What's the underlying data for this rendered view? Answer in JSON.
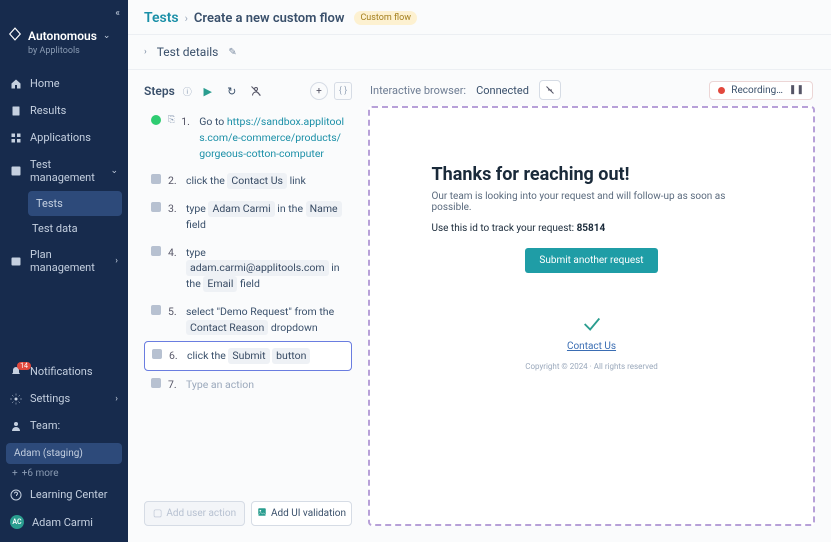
{
  "brand": {
    "name": "Autonomous",
    "subtitle": "by Applitools"
  },
  "nav": [
    {
      "label": "Home"
    },
    {
      "label": "Results"
    },
    {
      "label": "Applications"
    },
    {
      "label": "Test management",
      "children": [
        {
          "label": "Tests"
        },
        {
          "label": "Test data"
        }
      ]
    },
    {
      "label": "Plan management"
    }
  ],
  "bottom": {
    "notifications": "Notifications",
    "notif_badge": "14",
    "settings": "Settings",
    "team": "Team:",
    "team_selected": "Adam (staging)",
    "more": "+6 more",
    "learning": "Learning Center",
    "user_initials": "AC",
    "user_name": "Adam Carmi"
  },
  "header": {
    "root": "Tests",
    "title": "Create a new custom flow",
    "pill": "Custom flow",
    "details": "Test details"
  },
  "steps": {
    "title": "Steps",
    "items": [
      {
        "num": "1.",
        "pre": "Go to",
        "link": "https://sandbox.applitools.com/e-commerce/products/gorgeous-cotton-computer"
      },
      {
        "num": "2.",
        "t0": "click the",
        "c0": "Contact Us",
        "t1": "link"
      },
      {
        "num": "3.",
        "t0": "type",
        "c0": "Adam Carmi",
        "t1": "in the",
        "c1": "Name",
        "t2": "field"
      },
      {
        "num": "4.",
        "t0": "type",
        "c0": "adam.carmi@applitools.com",
        "t1": "in the",
        "c1": "Email",
        "t2": "field"
      },
      {
        "num": "5.",
        "t0": "select \"Demo Request\" from the",
        "c0": "Contact Reason",
        "t1": "dropdown"
      },
      {
        "num": "6.",
        "t0": "click the",
        "c0": "Submit",
        "c1": "button"
      },
      {
        "num": "7.",
        "placeholder": "Type an action"
      }
    ],
    "actions": {
      "add_user": "Add user action",
      "add_ui": "Add UI validation"
    }
  },
  "browser": {
    "label": "Interactive browser:",
    "status": "Connected",
    "recording": "Recording…"
  },
  "preview": {
    "heading": "Thanks for reaching out!",
    "body": "Our team is looking into your request and will follow-up as soon as possible.",
    "track_pre": "Use this id to track your request:",
    "track_id": "85814",
    "button": "Submit another request",
    "link": "Contact Us",
    "footer": "Copyright © 2024 · All rights reserved"
  }
}
